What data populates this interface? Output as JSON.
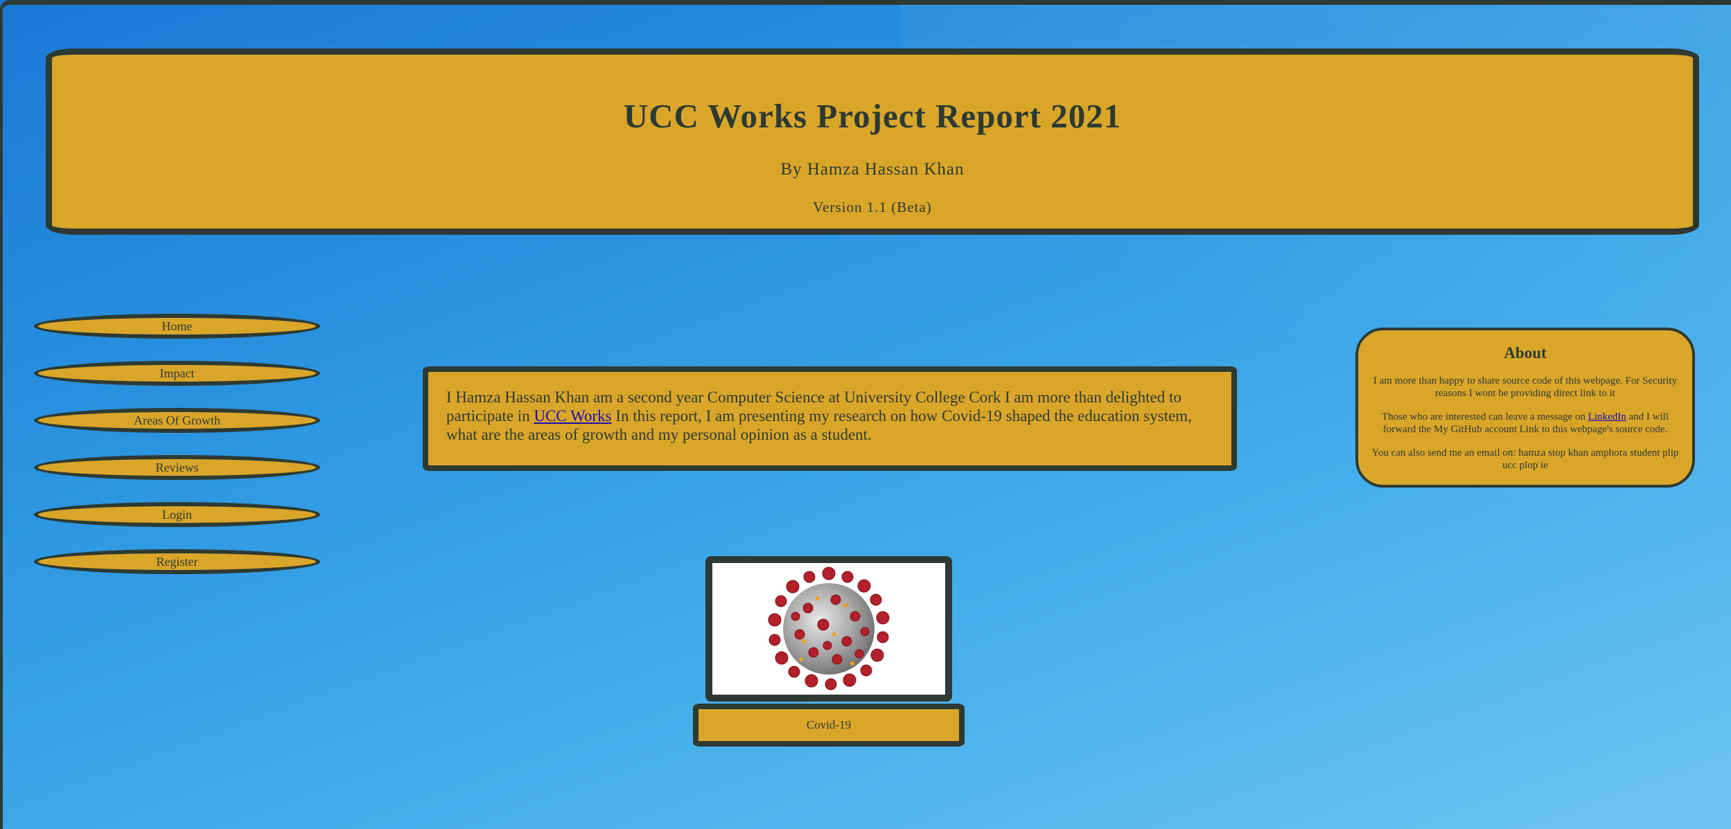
{
  "header": {
    "title": "UCC Works Project Report 2021",
    "byline": "By Hamza Hassan Khan",
    "version": "Version 1.1 (Beta)"
  },
  "nav": {
    "items": [
      {
        "label": "Home"
      },
      {
        "label": "Impact"
      },
      {
        "label": "Areas Of Growth"
      },
      {
        "label": "Reviews"
      },
      {
        "label": "Login"
      },
      {
        "label": "Register"
      }
    ]
  },
  "intro": {
    "text_before": "I Hamza Hassan Khan am a second year Computer Science at University College Cork I am more than delighted to participate in ",
    "link": "UCC Works",
    "text_after": " In this report, I am presenting my research on how Covid-19 shaped the education system, what are the areas of growth and my personal opinion as a student."
  },
  "about": {
    "title": "About",
    "para1": "I am more than happy to share source code of this webpage. For Security reasons I wont be providing direct link to it",
    "para2_before": "Those who are interested can leave a message on ",
    "para2_link": "LinkedIn",
    "para2_after": " and I will forward the My GitHub account Link to this webpage's source code.",
    "para3": "You can also send me an email on: hamza stop khan amphora student plip ucc plop ie"
  },
  "figure": {
    "image_icon": "coronavirus-icon",
    "caption": "Covid-19"
  },
  "colors": {
    "gold": "#daa629",
    "border": "#2d3a33",
    "link": "#1a0dab"
  }
}
